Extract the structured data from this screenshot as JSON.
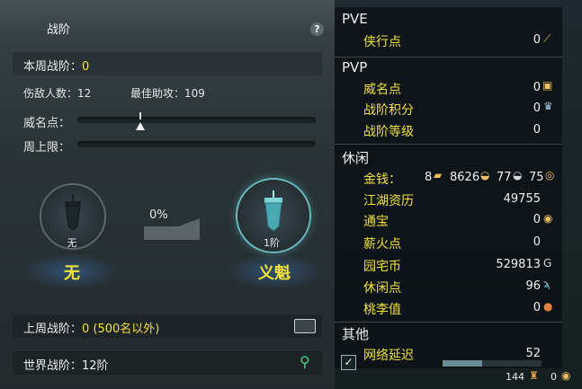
{
  "rank": {
    "title": "战阶",
    "help": "?",
    "weekly_label": "本周战阶：",
    "weekly_value": "0",
    "kills_label": "伤敌人数：",
    "kills_value": "12",
    "assists_label": "最佳助攻：",
    "assists_value": "109",
    "fame_label": "威名点：",
    "weekly_cap_label": "周上限：",
    "current_medal_small": "无",
    "current_medal_name": "无",
    "progress": "0%",
    "next_medal_small": "1阶",
    "next_medal_name": "义魁",
    "last_week_label": "上周战阶：",
    "last_week_value": "0 (500名以外)",
    "world_label": "世界战阶：",
    "world_value": "12阶"
  },
  "attributes": {
    "pve": {
      "header": "PVE",
      "items": [
        {
          "label": "侠行点",
          "value": "0"
        }
      ]
    },
    "pvp": {
      "header": "PVP",
      "items": [
        {
          "label": "威名点",
          "value": "0"
        },
        {
          "label": "战阶积分",
          "value": "0"
        },
        {
          "label": "战阶等级",
          "value": "0"
        }
      ]
    },
    "leisure": {
      "header": "休闲",
      "money_label": "金钱：",
      "money_gold": "8",
      "money_silver": "8626",
      "money_copper": "77",
      "money_iron": "75",
      "items": [
        {
          "label": "江湖资历",
          "value": "49755"
        },
        {
          "label": "通宝",
          "value": "0"
        },
        {
          "label": "薪火点",
          "value": "0"
        },
        {
          "label": "园宅币",
          "value": "529813"
        },
        {
          "label": "休闲点",
          "value": "96"
        },
        {
          "label": "桃李值",
          "value": "0"
        }
      ]
    },
    "other": {
      "header": "其他",
      "latency_label": "网络延迟",
      "latency_value": "52"
    },
    "footer": {
      "left_num": "144",
      "right_num": "0"
    }
  }
}
